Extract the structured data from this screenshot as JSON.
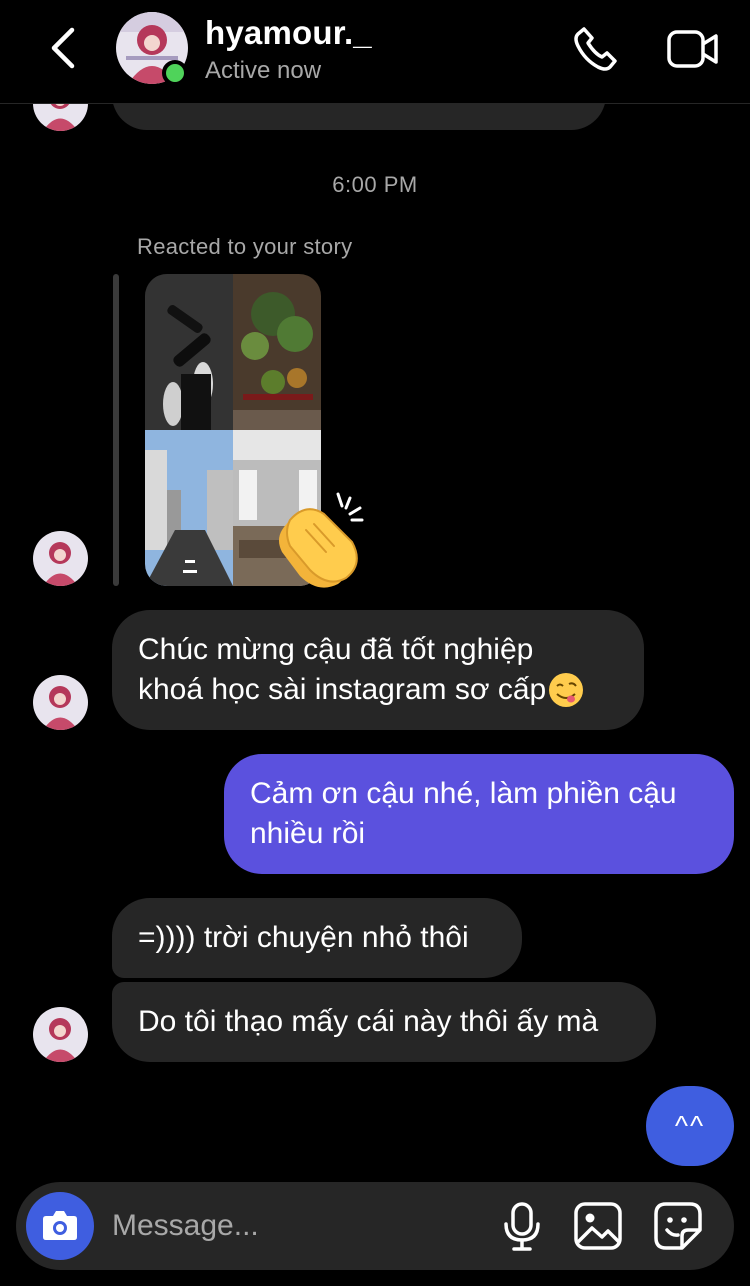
{
  "header": {
    "username": "hyamour._",
    "status": "Active now"
  },
  "chat": {
    "partial_message": ",,,,, .",
    "timestamp": "6:00 PM",
    "story_reply_label": "Reacted to your story",
    "story_reaction": "clapping-hands",
    "messages": [
      {
        "from": "them",
        "lines": [
          "Chúc mừng cậu đã tốt nghiệp",
          "khoá học sài instagram sơ cấp"
        ],
        "emoji": "face-savoring-food"
      },
      {
        "from": "me",
        "lines": [
          "Cảm ơn cậu nhé, làm phiền cậu",
          "nhiều rồi"
        ]
      },
      {
        "from": "them",
        "lines": [
          "=)))) trời chuyện nhỏ thôi"
        ]
      },
      {
        "from": "them",
        "lines": [
          "Do tôi thạo mấy cái này thôi ấy mà"
        ]
      }
    ]
  },
  "scroll_button": {
    "label": "^^"
  },
  "composer": {
    "placeholder": "Message..."
  },
  "colors": {
    "background": "#000000",
    "incoming_bubble": "#262626",
    "outgoing_bubble": "#5b51de",
    "accent_blue": "#3f5ee0",
    "online": "#4fd35a",
    "muted_text": "#a8a8a8"
  }
}
